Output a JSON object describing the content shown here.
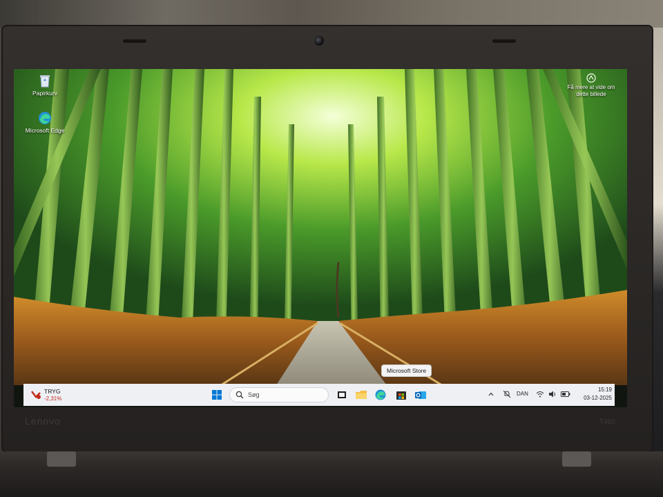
{
  "laptop": {
    "brand": "Lenovo",
    "model": "T460"
  },
  "desktop": {
    "icons": [
      {
        "label": "Papirkurv",
        "icon": "recycle-bin-icon"
      },
      {
        "label": "Microsoft Edge",
        "icon": "edge-icon"
      }
    ],
    "wallpaper_info": "Få mere at vide om dette billede"
  },
  "tooltip": "Microsoft Store",
  "taskbar": {
    "widget": {
      "name": "TRYG",
      "change": "-2,31%",
      "color": "#c42b1c"
    },
    "search_placeholder": "Søg",
    "apps": [
      "task-view-icon",
      "file-explorer-icon",
      "edge-icon",
      "microsoft-store-icon",
      "outlook-icon"
    ],
    "tray": {
      "language": "DAN",
      "time": "15:19",
      "date": "03-12-2025"
    }
  },
  "colors": {
    "taskbar_bg": "#eef0f4",
    "accent": "#0078d4"
  }
}
